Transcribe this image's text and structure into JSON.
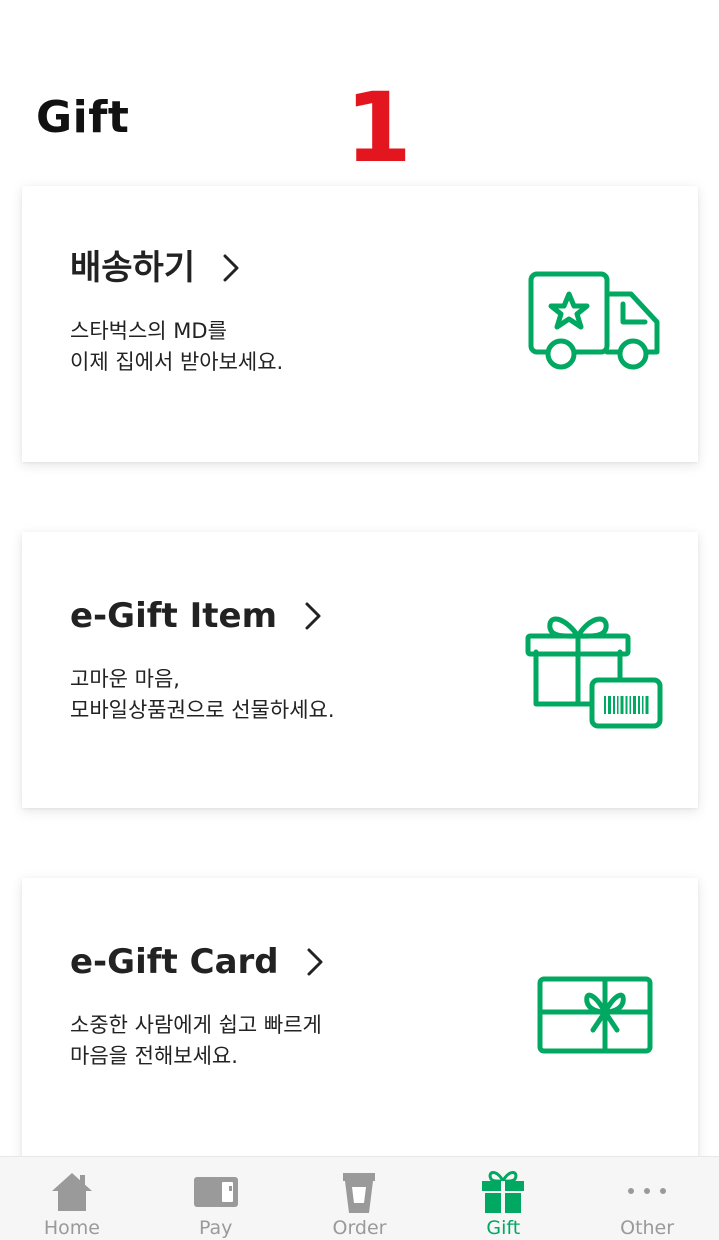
{
  "header": {
    "title": "Gift",
    "step_badge": "1"
  },
  "cards": [
    {
      "title": "배송하기",
      "desc_lines": [
        "스타벅스의 MD를",
        "이제 집에서 받아보세요."
      ],
      "icon": "delivery-truck-icon"
    },
    {
      "title": "e-Gift Item",
      "desc_lines": [
        "고마운 마음,",
        "모바일상품권으로 선물하세요."
      ],
      "icon": "gift-box-barcode-icon"
    },
    {
      "title": "e-Gift Card",
      "desc_lines": [
        "소중한 사람에게 쉽고 빠르게",
        "마음을 전해보세요."
      ],
      "icon": "gift-card-icon"
    }
  ],
  "tabs": [
    {
      "label": "Home",
      "icon": "home-icon",
      "active": false
    },
    {
      "label": "Pay",
      "icon": "card-icon",
      "active": false
    },
    {
      "label": "Order",
      "icon": "cup-icon",
      "active": false
    },
    {
      "label": "Gift",
      "icon": "gift-icon",
      "active": true
    },
    {
      "label": "Other",
      "icon": "more-dots-icon",
      "active": false
    }
  ],
  "colors": {
    "brand_green": "#00a862",
    "badge_red": "#e3161f",
    "tab_inactive": "#9a9a9a"
  }
}
